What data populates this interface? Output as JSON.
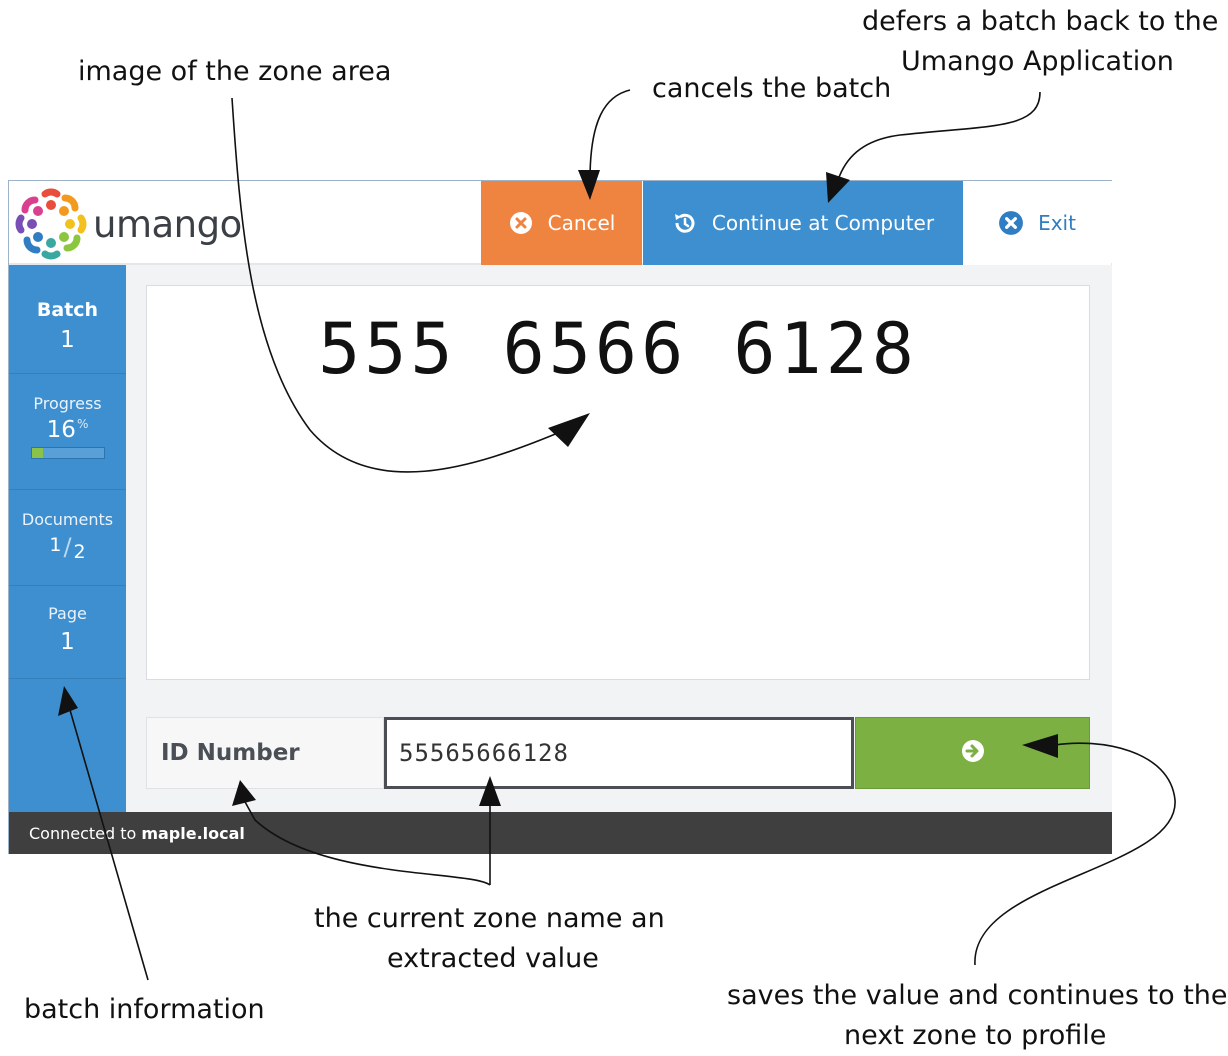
{
  "annotations": {
    "defers_line1": "defers a batch back to the",
    "defers_line2": "Umango Application",
    "image_of_zone": "image of the zone area",
    "cancels_batch": "cancels the batch",
    "zone_name_line1": "the current zone name an",
    "zone_name_line2": "extracted value",
    "batch_information": "batch information",
    "saves_line1": "saves the value and continues to the",
    "saves_line2": "next zone to profile"
  },
  "app": {
    "logo_text": "umango",
    "header": {
      "cancel_label": "Cancel",
      "continue_label": "Continue at Computer",
      "exit_label": "Exit"
    },
    "sidebar": {
      "batch_label": "Batch",
      "batch_value": "1",
      "progress_label": "Progress",
      "progress_value": "16",
      "progress_unit": "%",
      "progress_fraction": 0.16,
      "documents_label": "Documents",
      "documents_current": "1",
      "documents_separator": "/",
      "documents_total": "2",
      "page_label": "Page",
      "page_value": "1"
    },
    "zone": {
      "image_text": "555 6566 6128",
      "name": "ID Number",
      "value": "55565666128"
    },
    "footer": {
      "prefix": "Connected to",
      "host": "maple.local"
    }
  },
  "colors": {
    "cancel": "#ef8340",
    "continue": "#3d8fcf",
    "sidebar": "#3d8fcf",
    "next": "#7cb043",
    "footer": "#3f3f3f"
  },
  "icons": {
    "cancel": "x-circle-icon",
    "continue": "history-icon",
    "exit": "x-circle-icon",
    "next": "arrow-right-circle-icon",
    "logo": "umango-flower-logo"
  }
}
